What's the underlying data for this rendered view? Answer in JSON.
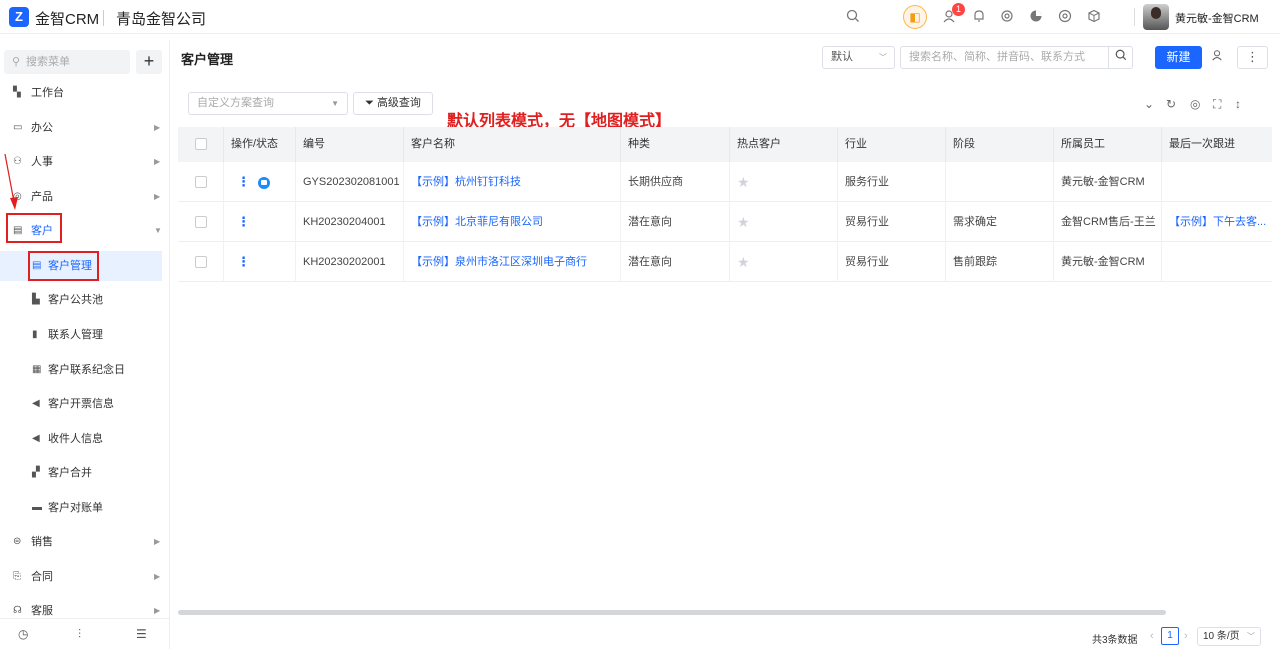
{
  "app": {
    "brand": "金智CRM",
    "company": "青岛金智公司",
    "logo_letter": "Z"
  },
  "topbar": {
    "notification_count": "1",
    "user_name": "黄元敏-金智CRM",
    "icons": [
      "search-icon",
      "sound-icon",
      "contacts-icon",
      "bell-icon",
      "settings-icon",
      "pie-chart-icon",
      "chrome-icon",
      "cube-icon"
    ]
  },
  "sidebar": {
    "search_placeholder": "搜索菜单",
    "add_label": "+",
    "items": [
      {
        "label": "工作台",
        "icon": "dashboard-icon",
        "has_arrow": false
      },
      {
        "label": "办公",
        "icon": "office-icon",
        "has_arrow": true
      },
      {
        "label": "人事",
        "icon": "org-icon",
        "has_arrow": true
      },
      {
        "label": "产品",
        "icon": "product-icon",
        "has_arrow": true
      },
      {
        "label": "客户",
        "icon": "customer-icon",
        "has_arrow": true,
        "expanded": true
      }
    ],
    "sub_items": [
      {
        "label": "客户管理",
        "icon": "customer-icon",
        "active": true
      },
      {
        "label": "客户公共池",
        "icon": "pool-icon"
      },
      {
        "label": "联系人管理",
        "icon": "contact-card-icon"
      },
      {
        "label": "客户联系纪念日",
        "icon": "calendar-icon"
      },
      {
        "label": "客户开票信息",
        "icon": "invoice-icon"
      },
      {
        "label": "收件人信息",
        "icon": "recipient-icon"
      },
      {
        "label": "客户合并",
        "icon": "merge-icon"
      },
      {
        "label": "客户对账单",
        "icon": "statement-icon"
      }
    ],
    "bottom_items": [
      {
        "label": "销售",
        "icon": "sales-icon"
      },
      {
        "label": "合同",
        "icon": "contract-icon"
      },
      {
        "label": "客服",
        "icon": "service-icon"
      }
    ]
  },
  "header": {
    "title": "客户管理",
    "view_select": "默认",
    "search_placeholder": "搜索名称、简称、拼音码、联系方式",
    "new_button": "新建"
  },
  "toolbar": {
    "scheme_placeholder": "自定义方案查询",
    "advanced_search": "高级查询",
    "annotation": "默认列表模式，无【地图模式】"
  },
  "table": {
    "columns": [
      "操作/状态",
      "编号",
      "客户名称",
      "种类",
      "热点客户",
      "行业",
      "阶段",
      "所属员工",
      "最后一次跟进"
    ],
    "rows": [
      {
        "code": "GYS202302081001",
        "name": "【示例】杭州钉钉科技",
        "kind": "长期供应商",
        "industry": "服务行业",
        "stage": "",
        "owner": "黄元敏-金智CRM",
        "last": "",
        "has_status": true
      },
      {
        "code": "KH20230204001",
        "name": "【示例】北京菲尼有限公司",
        "kind": "潜在意向",
        "industry": "贸易行业",
        "stage": "需求确定",
        "owner": "金智CRM售后-王兰",
        "last": "【示例】下午去客...",
        "has_status": false
      },
      {
        "code": "KH20230202001",
        "name": "【示例】泉州市洛江区深圳电子商行",
        "kind": "潜在意向",
        "industry": "贸易行业",
        "stage": "售前跟踪",
        "owner": "黄元敏-金智CRM",
        "last": "",
        "has_status": false
      }
    ]
  },
  "pager": {
    "total": "共3条数据",
    "page": "1",
    "size": "10 条/页"
  },
  "colors": {
    "primary": "#1a66ff",
    "annotation": "#e02020"
  }
}
